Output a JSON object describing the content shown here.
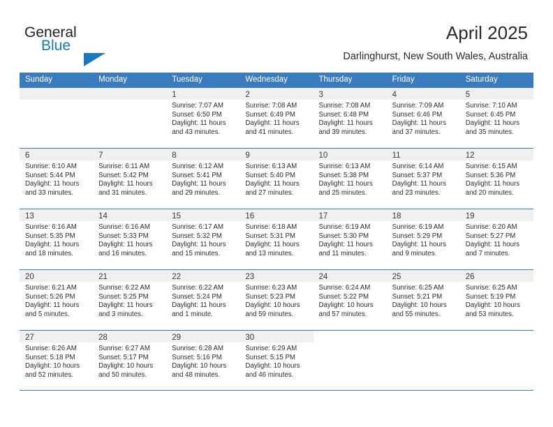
{
  "brand": {
    "name_part1": "General",
    "name_part2": "Blue",
    "triangle_color": "#1878be"
  },
  "header": {
    "title": "April 2025",
    "subtitle": "Darlinghurst, New South Wales, Australia"
  },
  "theme": {
    "header_blue": "#3b7cbf",
    "band_gray": "#f0f0f0",
    "text": "#2d2d2d"
  },
  "calendar": {
    "weekday_headers": [
      "Sunday",
      "Monday",
      "Tuesday",
      "Wednesday",
      "Thursday",
      "Friday",
      "Saturday"
    ],
    "weeks": [
      [
        {
          "day": "",
          "type": "empty",
          "lines": []
        },
        {
          "day": "",
          "type": "empty",
          "lines": []
        },
        {
          "day": "1",
          "type": "day",
          "lines": [
            "Sunrise: 7:07 AM",
            "Sunset: 6:50 PM",
            "Daylight: 11 hours",
            "and 43 minutes."
          ]
        },
        {
          "day": "2",
          "type": "day",
          "lines": [
            "Sunrise: 7:08 AM",
            "Sunset: 6:49 PM",
            "Daylight: 11 hours",
            "and 41 minutes."
          ]
        },
        {
          "day": "3",
          "type": "day",
          "lines": [
            "Sunrise: 7:08 AM",
            "Sunset: 6:48 PM",
            "Daylight: 11 hours",
            "and 39 minutes."
          ]
        },
        {
          "day": "4",
          "type": "day",
          "lines": [
            "Sunrise: 7:09 AM",
            "Sunset: 6:46 PM",
            "Daylight: 11 hours",
            "and 37 minutes."
          ]
        },
        {
          "day": "5",
          "type": "day",
          "lines": [
            "Sunrise: 7:10 AM",
            "Sunset: 6:45 PM",
            "Daylight: 11 hours",
            "and 35 minutes."
          ]
        }
      ],
      [
        {
          "day": "6",
          "type": "day",
          "lines": [
            "Sunrise: 6:10 AM",
            "Sunset: 5:44 PM",
            "Daylight: 11 hours",
            "and 33 minutes."
          ]
        },
        {
          "day": "7",
          "type": "day",
          "lines": [
            "Sunrise: 6:11 AM",
            "Sunset: 5:42 PM",
            "Daylight: 11 hours",
            "and 31 minutes."
          ]
        },
        {
          "day": "8",
          "type": "day",
          "lines": [
            "Sunrise: 6:12 AM",
            "Sunset: 5:41 PM",
            "Daylight: 11 hours",
            "and 29 minutes."
          ]
        },
        {
          "day": "9",
          "type": "day",
          "lines": [
            "Sunrise: 6:13 AM",
            "Sunset: 5:40 PM",
            "Daylight: 11 hours",
            "and 27 minutes."
          ]
        },
        {
          "day": "10",
          "type": "day",
          "lines": [
            "Sunrise: 6:13 AM",
            "Sunset: 5:38 PM",
            "Daylight: 11 hours",
            "and 25 minutes."
          ]
        },
        {
          "day": "11",
          "type": "day",
          "lines": [
            "Sunrise: 6:14 AM",
            "Sunset: 5:37 PM",
            "Daylight: 11 hours",
            "and 23 minutes."
          ]
        },
        {
          "day": "12",
          "type": "day",
          "lines": [
            "Sunrise: 6:15 AM",
            "Sunset: 5:36 PM",
            "Daylight: 11 hours",
            "and 20 minutes."
          ]
        }
      ],
      [
        {
          "day": "13",
          "type": "day",
          "lines": [
            "Sunrise: 6:16 AM",
            "Sunset: 5:35 PM",
            "Daylight: 11 hours",
            "and 18 minutes."
          ]
        },
        {
          "day": "14",
          "type": "day",
          "lines": [
            "Sunrise: 6:16 AM",
            "Sunset: 5:33 PM",
            "Daylight: 11 hours",
            "and 16 minutes."
          ]
        },
        {
          "day": "15",
          "type": "day",
          "lines": [
            "Sunrise: 6:17 AM",
            "Sunset: 5:32 PM",
            "Daylight: 11 hours",
            "and 15 minutes."
          ]
        },
        {
          "day": "16",
          "type": "day",
          "lines": [
            "Sunrise: 6:18 AM",
            "Sunset: 5:31 PM",
            "Daylight: 11 hours",
            "and 13 minutes."
          ]
        },
        {
          "day": "17",
          "type": "day",
          "lines": [
            "Sunrise: 6:19 AM",
            "Sunset: 5:30 PM",
            "Daylight: 11 hours",
            "and 11 minutes."
          ]
        },
        {
          "day": "18",
          "type": "day",
          "lines": [
            "Sunrise: 6:19 AM",
            "Sunset: 5:29 PM",
            "Daylight: 11 hours",
            "and 9 minutes."
          ]
        },
        {
          "day": "19",
          "type": "day",
          "lines": [
            "Sunrise: 6:20 AM",
            "Sunset: 5:27 PM",
            "Daylight: 11 hours",
            "and 7 minutes."
          ]
        }
      ],
      [
        {
          "day": "20",
          "type": "day",
          "lines": [
            "Sunrise: 6:21 AM",
            "Sunset: 5:26 PM",
            "Daylight: 11 hours",
            "and 5 minutes."
          ]
        },
        {
          "day": "21",
          "type": "day",
          "lines": [
            "Sunrise: 6:22 AM",
            "Sunset: 5:25 PM",
            "Daylight: 11 hours",
            "and 3 minutes."
          ]
        },
        {
          "day": "22",
          "type": "day",
          "lines": [
            "Sunrise: 6:22 AM",
            "Sunset: 5:24 PM",
            "Daylight: 11 hours",
            "and 1 minute."
          ]
        },
        {
          "day": "23",
          "type": "day",
          "lines": [
            "Sunrise: 6:23 AM",
            "Sunset: 5:23 PM",
            "Daylight: 10 hours",
            "and 59 minutes."
          ]
        },
        {
          "day": "24",
          "type": "day",
          "lines": [
            "Sunrise: 6:24 AM",
            "Sunset: 5:22 PM",
            "Daylight: 10 hours",
            "and 57 minutes."
          ]
        },
        {
          "day": "25",
          "type": "day",
          "lines": [
            "Sunrise: 6:25 AM",
            "Sunset: 5:21 PM",
            "Daylight: 10 hours",
            "and 55 minutes."
          ]
        },
        {
          "day": "26",
          "type": "day",
          "lines": [
            "Sunrise: 6:25 AM",
            "Sunset: 5:19 PM",
            "Daylight: 10 hours",
            "and 53 minutes."
          ]
        }
      ],
      [
        {
          "day": "27",
          "type": "day",
          "lines": [
            "Sunrise: 6:26 AM",
            "Sunset: 5:18 PM",
            "Daylight: 10 hours",
            "and 52 minutes."
          ]
        },
        {
          "day": "28",
          "type": "day",
          "lines": [
            "Sunrise: 6:27 AM",
            "Sunset: 5:17 PM",
            "Daylight: 10 hours",
            "and 50 minutes."
          ]
        },
        {
          "day": "29",
          "type": "day",
          "lines": [
            "Sunrise: 6:28 AM",
            "Sunset: 5:16 PM",
            "Daylight: 10 hours",
            "and 48 minutes."
          ]
        },
        {
          "day": "30",
          "type": "day",
          "lines": [
            "Sunrise: 6:29 AM",
            "Sunset: 5:15 PM",
            "Daylight: 10 hours",
            "and 46 minutes."
          ]
        },
        {
          "day": "",
          "type": "blank",
          "lines": []
        },
        {
          "day": "",
          "type": "blank",
          "lines": []
        },
        {
          "day": "",
          "type": "blank",
          "lines": []
        }
      ]
    ]
  }
}
